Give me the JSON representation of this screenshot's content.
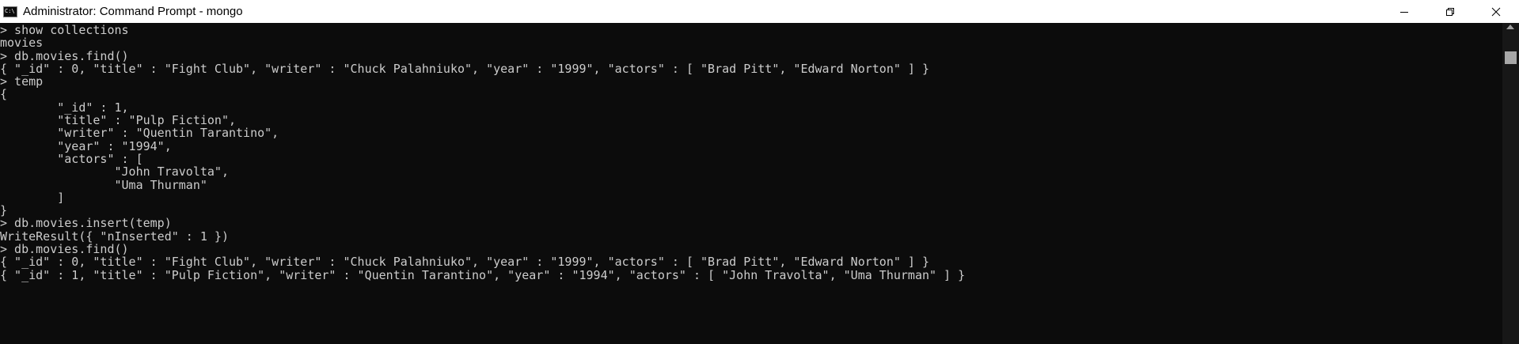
{
  "window": {
    "title": "Administrator: Command Prompt - mongo",
    "icon": "cmd-icon",
    "icon_text": "C:\\"
  },
  "controls": {
    "minimize": "minimize-icon",
    "maximize": "restore-icon",
    "close": "close-icon"
  },
  "terminal": {
    "lines": [
      "> show collections",
      "movies",
      "> db.movies.find()",
      "{ \"_id\" : 0, \"title\" : \"Fight Club\", \"writer\" : \"Chuck Palahniuko\", \"year\" : \"1999\", \"actors\" : [ \"Brad Pitt\", \"Edward Norton\" ] }",
      "> temp",
      "{",
      "        \"_id\" : 1,",
      "        \"title\" : \"Pulp Fiction\",",
      "        \"writer\" : \"Quentin Tarantino\",",
      "        \"year\" : \"1994\",",
      "        \"actors\" : [",
      "                \"John Travolta\",",
      "                \"Uma Thurman\"",
      "        ]",
      "}",
      "> db.movies.insert(temp)",
      "WriteResult({ \"nInserted\" : 1 })",
      "> db.movies.find()",
      "{ \"_id\" : 0, \"title\" : \"Fight Club\", \"writer\" : \"Chuck Palahniuko\", \"year\" : \"1999\", \"actors\" : [ \"Brad Pitt\", \"Edward Norton\" ] }",
      "{ \"_id\" : 1, \"title\" : \"Pulp Fiction\", \"writer\" : \"Quentin Tarantino\", \"year\" : \"1994\", \"actors\" : [ \"John Travolta\", \"Uma Thurman\" ] }"
    ]
  },
  "colors": {
    "background": "#0c0c0c",
    "foreground": "#cccccc",
    "titlebar": "#ffffff"
  }
}
